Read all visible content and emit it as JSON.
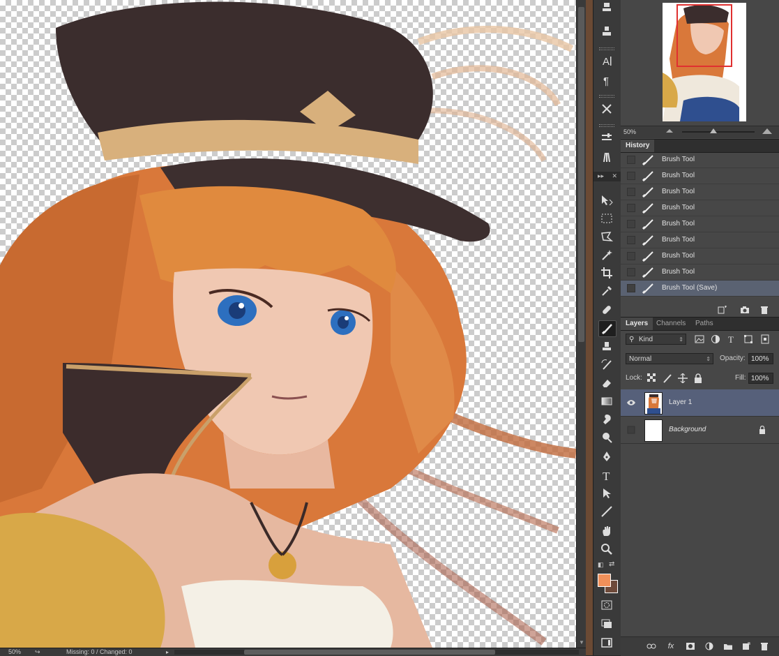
{
  "status": {
    "zoom": "50%",
    "info": "Missing: 0 / Changed: 0"
  },
  "navigator": {
    "zoom": "50%"
  },
  "history": {
    "tab": "History",
    "items": [
      {
        "label": "Brush Tool"
      },
      {
        "label": "Brush Tool"
      },
      {
        "label": "Brush Tool"
      },
      {
        "label": "Brush Tool"
      },
      {
        "label": "Brush Tool"
      },
      {
        "label": "Brush Tool"
      },
      {
        "label": "Brush Tool"
      },
      {
        "label": "Brush Tool"
      },
      {
        "label": "Brush Tool (Save)"
      }
    ],
    "selected_index": 8
  },
  "layers_panel": {
    "tabs": [
      "Layers",
      "Channels",
      "Paths"
    ],
    "active_tab": "Layers",
    "filter_kind": "Kind",
    "blend_mode": "Normal",
    "opacity_label": "Opacity:",
    "opacity": "100%",
    "lock_label": "Lock:",
    "fill_label": "Fill:",
    "fill": "100%",
    "layers": [
      {
        "name": "Layer 1",
        "visible": true,
        "selected": true
      },
      {
        "name": "Background",
        "visible": false,
        "locked": true
      }
    ]
  },
  "toolbar": {
    "tools": [
      "move-tool",
      "marquee-tool",
      "lasso-tool",
      "magic-wand-tool",
      "crop-tool",
      "eyedropper-tool",
      "healing-brush-tool",
      "brush-tool",
      "clone-stamp-tool",
      "history-brush-tool",
      "eraser-tool",
      "gradient-tool",
      "blur-tool",
      "dodge-tool",
      "pen-tool",
      "type-tool",
      "path-selection-tool",
      "line-tool",
      "hand-tool",
      "zoom-tool"
    ],
    "active_tool": "brush-tool",
    "foreground_color": "#f0905a",
    "background_color": "#6e4a3a"
  },
  "colors": {
    "selection_highlight": "#5a6272",
    "layer_selected": "#56607a"
  }
}
